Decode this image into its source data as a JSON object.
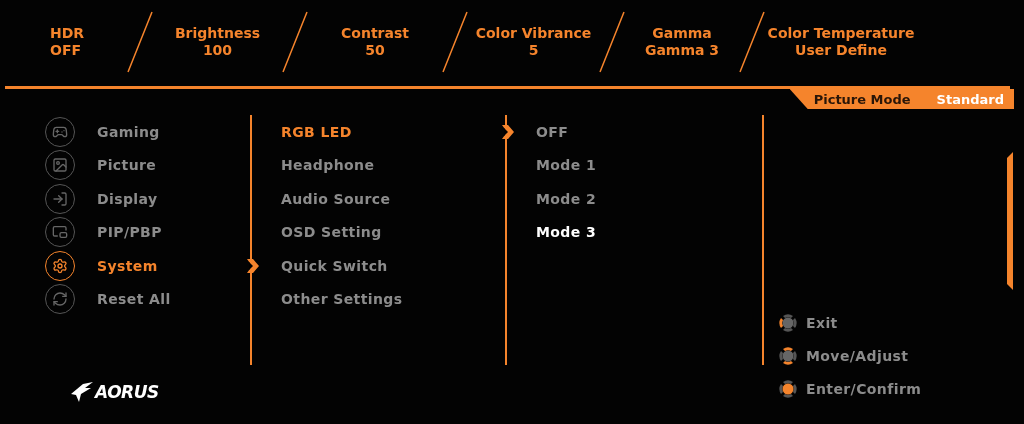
{
  "status_items": [
    {
      "label": "HDR",
      "value": "OFF"
    },
    {
      "label": "Brightness",
      "value": "100"
    },
    {
      "label": "Contrast",
      "value": "50"
    },
    {
      "label": "Color Vibrance",
      "value": "5"
    },
    {
      "label": "Gamma",
      "value": "Gamma 3"
    },
    {
      "label": "Color Temperature",
      "value": "User Define"
    }
  ],
  "picture_mode": {
    "label": "Picture Mode",
    "value": "Standard"
  },
  "main_menu": [
    {
      "label": "Gaming",
      "kind": "gamepad",
      "selected": false
    },
    {
      "label": "Picture",
      "kind": "picture",
      "selected": false
    },
    {
      "label": "Display",
      "kind": "input",
      "selected": false
    },
    {
      "label": "PIP/PBP",
      "kind": "pip",
      "selected": false
    },
    {
      "label": "System",
      "kind": "gear",
      "selected": true
    },
    {
      "label": "Reset All",
      "kind": "reset",
      "selected": false
    }
  ],
  "logo": {
    "text": "AORUS"
  },
  "sub_menu": [
    {
      "label": "RGB LED",
      "selected": true
    },
    {
      "label": "Headphone",
      "selected": false
    },
    {
      "label": "Audio Source",
      "selected": false
    },
    {
      "label": "OSD Setting",
      "selected": false
    },
    {
      "label": "Quick Switch",
      "selected": false
    },
    {
      "label": "Other Settings",
      "selected": false
    }
  ],
  "options": [
    {
      "label": "OFF",
      "selected": false
    },
    {
      "label": "Mode 1",
      "selected": false
    },
    {
      "label": "Mode 2",
      "selected": false
    },
    {
      "label": "Mode 3",
      "selected": true
    }
  ],
  "hints": [
    {
      "label": "Exit",
      "kind": "left"
    },
    {
      "label": "Move/Adjust",
      "kind": "updown"
    },
    {
      "label": "Enter/Confirm",
      "kind": "press"
    }
  ]
}
